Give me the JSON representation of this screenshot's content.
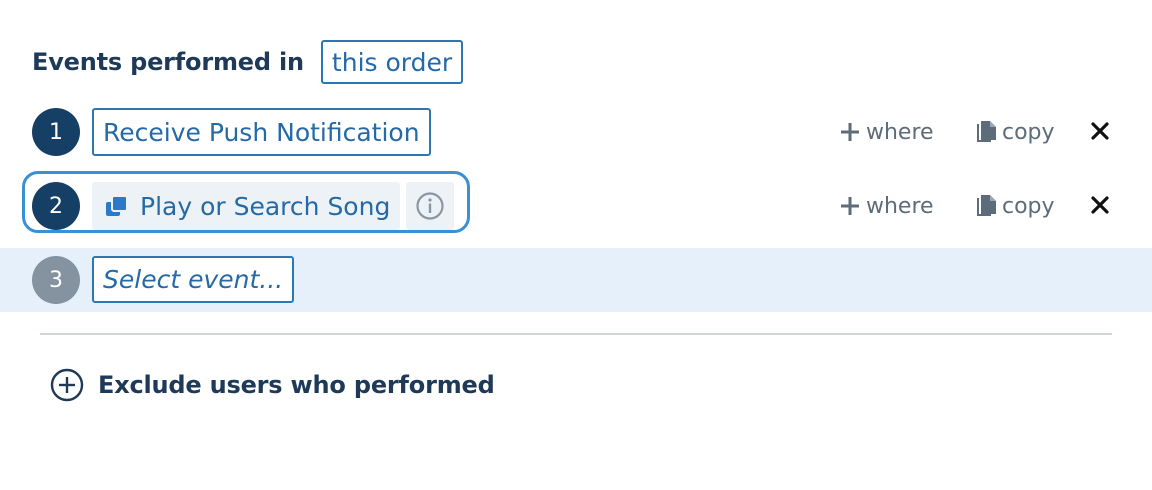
{
  "header": {
    "label": "Events performed in",
    "order_button": "this order"
  },
  "steps": [
    {
      "number": "1",
      "event": "Receive Push Notification",
      "where": "where",
      "copy": "copy"
    },
    {
      "number": "2",
      "event": "Play or Search Song",
      "where": "where",
      "copy": "copy",
      "icons": [
        "cohort-event-icon",
        "info-icon"
      ]
    },
    {
      "number": "3",
      "event_placeholder": "Select event..."
    }
  ],
  "exclude": {
    "label": "Exclude users who performed"
  },
  "colors": {
    "step_badge": "#163f66",
    "step_badge_muted": "#8593a1",
    "accent_blue": "#2569a6",
    "focus_ring": "#3b8fd3",
    "active_row_bg": "#e6f0fa"
  }
}
